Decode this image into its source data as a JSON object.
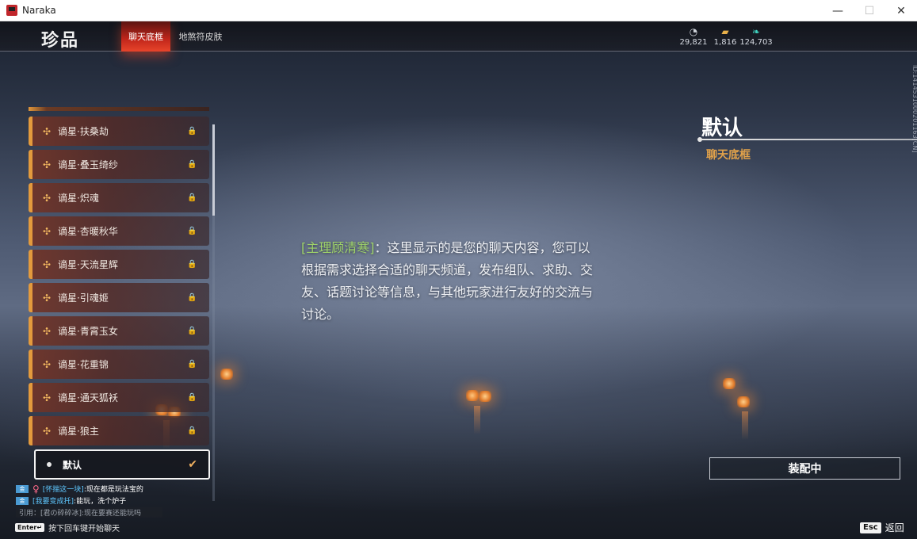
{
  "window": {
    "title": "Naraka",
    "minimize": "—",
    "maximize": "☐",
    "close": "✕"
  },
  "header": {
    "page_title": "珍品",
    "tabs": [
      {
        "label": "聊天底框"
      },
      {
        "label": "地煞符皮肤"
      }
    ],
    "currencies": [
      {
        "icon": "coin-stack-icon",
        "glyph": "◔",
        "value": "29,821",
        "color": "#cfd3da"
      },
      {
        "icon": "gold-ticket-icon",
        "glyph": "▰",
        "value": "1,816",
        "color": "#e8b04a"
      },
      {
        "icon": "jade-feather-icon",
        "glyph": "❧",
        "value": "124,703",
        "color": "#3fd3c0"
      }
    ]
  },
  "list": {
    "items": [
      {
        "label": "谪星·扶桑劫",
        "locked": true
      },
      {
        "label": "谪星·叠玉绮纱",
        "locked": true
      },
      {
        "label": "谪星·炽魂",
        "locked": true
      },
      {
        "label": "谪星·杏暖秋华",
        "locked": true
      },
      {
        "label": "谪星·天流星辉",
        "locked": true
      },
      {
        "label": "谪星·引魂姬",
        "locked": true
      },
      {
        "label": "谪星·青霄玉女",
        "locked": true
      },
      {
        "label": "谪星·花重锦",
        "locked": true
      },
      {
        "label": "谪星·通天狐袄",
        "locked": true
      },
      {
        "label": "谪星·狼主",
        "locked": true
      }
    ],
    "selected": {
      "label": "默认",
      "equipped": true
    },
    "star_glyph": "✣",
    "lock_glyph": "🔒",
    "check_glyph": "✔"
  },
  "preview": {
    "speaker": "[主理顾清寒]",
    "text": "：这里显示的是您的聊天内容，您可以根据需求选择合适的聊天频道，发布组队、求助、交友、话题讨论等信息，与其他玩家进行友好的交流与讨论。"
  },
  "info": {
    "title": "默认",
    "subtitle": "聊天底框",
    "player_id": "ID:1414531000201163[CN]",
    "equip_button": "装配中"
  },
  "chat": {
    "lines": [
      {
        "channel": "金",
        "gender": "♀",
        "player": "[怀揣这一块]",
        "message": ":现在都是玩法宝的"
      },
      {
        "channel": "金",
        "player": "[我要变成托]",
        "message": ":能玩，洗个炉子"
      }
    ],
    "quote": "引用：[君の碎碎冰]:现在要赛还能玩吗",
    "hint_key": "Enter↵",
    "hint_text": "按下回车键开始聊天"
  },
  "footer": {
    "back_key": "Esc",
    "back_label": "返回"
  },
  "colors": {
    "accent_red": "#c2261b",
    "accent_orange": "#e39a3d",
    "speaker_green": "#9fd36a",
    "player_blue": "#5fc8ff"
  }
}
